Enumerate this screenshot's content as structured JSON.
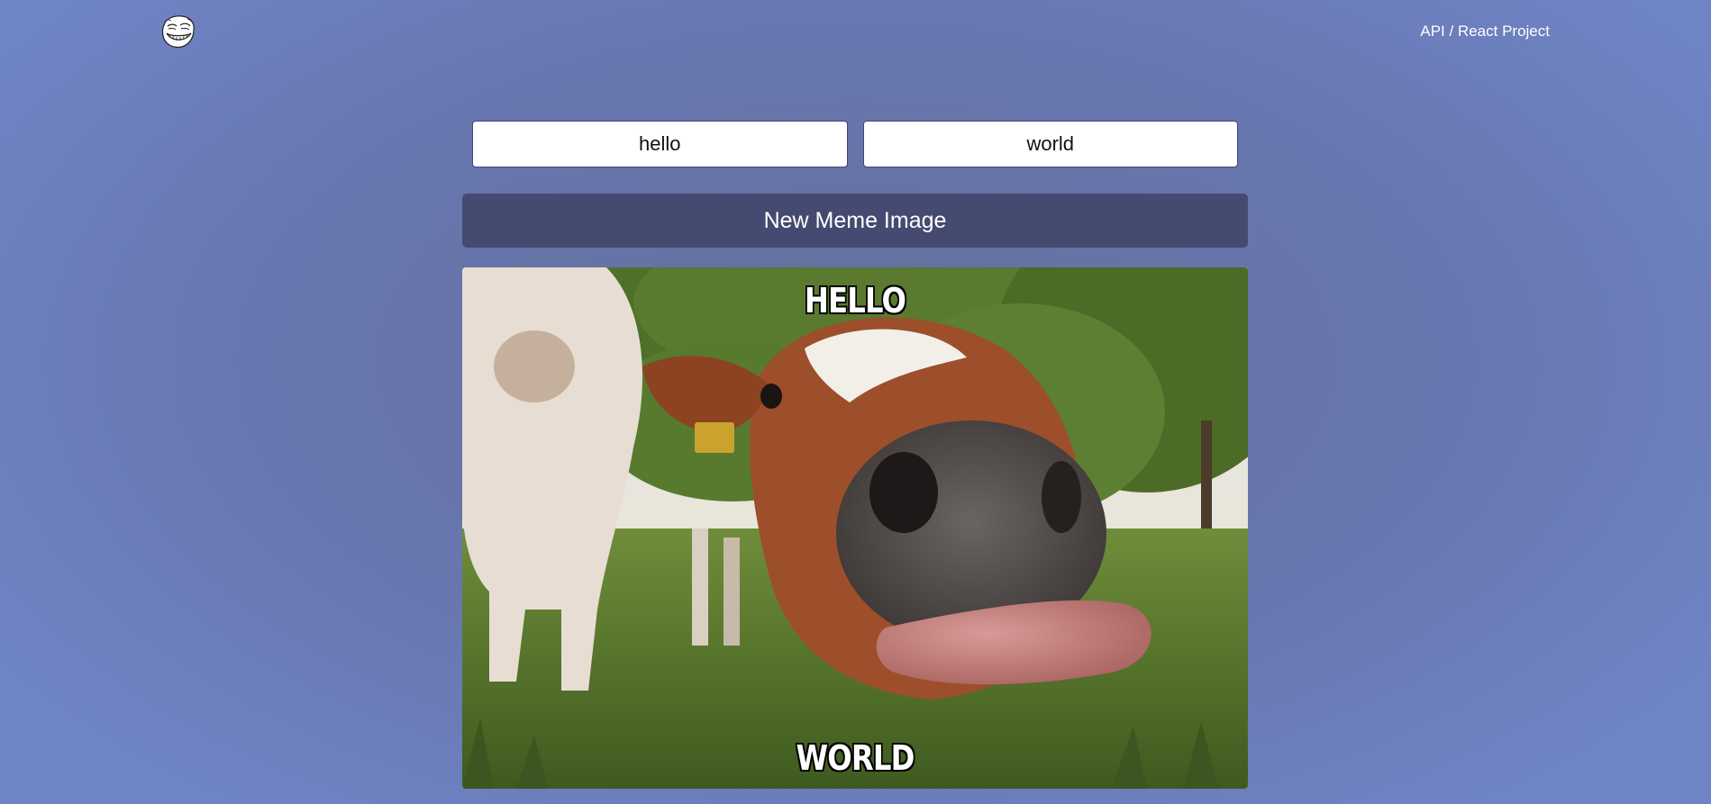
{
  "header": {
    "logo_icon": "troll-face-icon",
    "nav_link": "API / React Project"
  },
  "form": {
    "top_text_value": "hello",
    "bottom_text_value": "world",
    "button_label": "New Meme Image"
  },
  "meme": {
    "image_subject": "cow-closeup-tongue-out",
    "top_text": "HELLO",
    "bottom_text": "WORLD"
  },
  "colors": {
    "background": "#6877b0",
    "button": "#454a70",
    "input_border": "#3d4582"
  }
}
